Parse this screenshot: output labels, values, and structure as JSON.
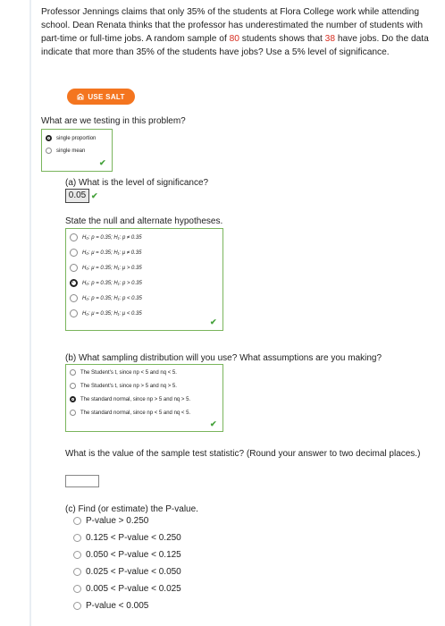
{
  "problem": {
    "text1": "Professor Jennings claims that only 35% of the students at Flora College work while attending school. Dean Renata thinks that the professor has underestimated the number of students with part-time or full-time jobs. A random sample of ",
    "n": "80",
    "text2": " students shows that ",
    "x": "38",
    "text3": " have jobs. Do the data indicate that more than 35% of the students have jobs? Use a 5% level of significance."
  },
  "salt_button": "USE SALT",
  "q_test": "What are we testing in this problem?",
  "test_options": [
    "single proportion",
    "single mean"
  ],
  "q_a": "(a) What is the level of significance?",
  "alpha_value": "0.05",
  "q_hyp": "State the null and alternate hypotheses.",
  "hypotheses": [
    "H₀: p = 0.35; H₁: p ≠ 0.35",
    "H₀: μ = 0.35; H₁: μ ≠ 0.35",
    "H₀: μ = 0.35; H₁: μ > 0.35",
    "H₀: p = 0.35; H₁: p > 0.35",
    "H₀: p = 0.35; H₁: p < 0.35",
    "H₀: μ = 0.35; H₁: μ < 0.35"
  ],
  "q_b": "(b) What sampling distribution will you use? What assumptions are you making?",
  "distribution_options": [
    "The Student's t, since np < 5 and nq < 5.",
    "The Student's t, since np > 5 and nq > 5.",
    "The standard normal, since np > 5 and nq > 5.",
    "The standard normal, since np < 5 and nq < 5."
  ],
  "q_stat": "What is the value of the sample test statistic? (Round your answer to two decimal places.)",
  "q_c": "(c) Find (or estimate) the P-value.",
  "pvalue_options": [
    "P-value > 0.250",
    "0.125 < P-value < 0.250",
    "0.050 < P-value < 0.125",
    "0.025 < P-value < 0.050",
    "0.005 < P-value < 0.025",
    "P-value < 0.005"
  ],
  "colors": {
    "accent": "#f4751f",
    "highlight": "#d62d20",
    "correct": "#46a23c",
    "border": "#7ab55c"
  }
}
